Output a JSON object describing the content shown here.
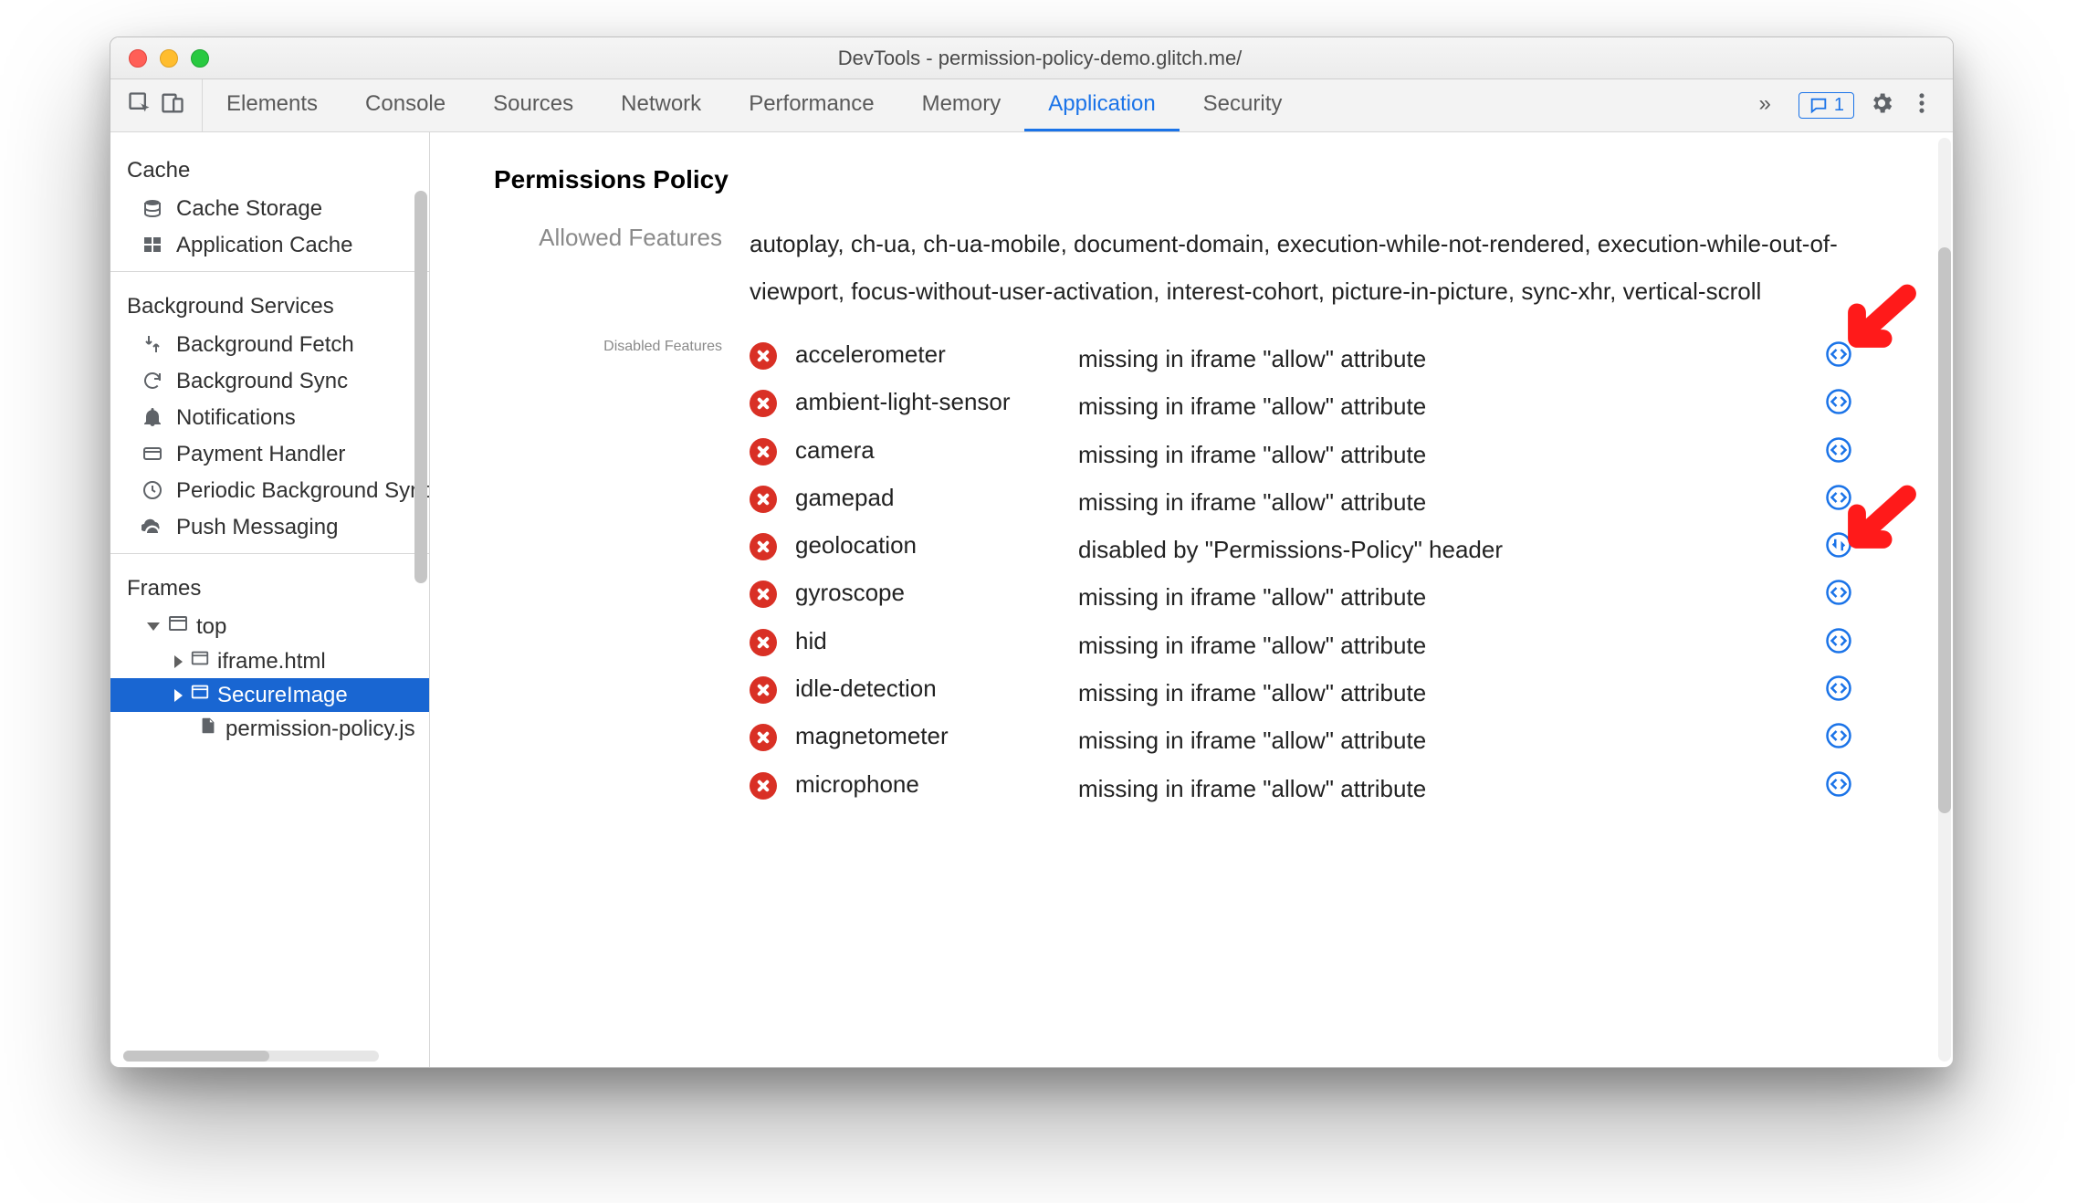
{
  "window_title": "DevTools - permission-policy-demo.glitch.me/",
  "tabs": {
    "items": [
      "Elements",
      "Console",
      "Sources",
      "Network",
      "Performance",
      "Memory",
      "Application",
      "Security"
    ],
    "active": "Application",
    "overflow_glyph": "»",
    "feedback_count": "1"
  },
  "sidebar": {
    "cache": {
      "title": "Cache",
      "items": [
        "Cache Storage",
        "Application Cache"
      ]
    },
    "bg": {
      "title": "Background Services",
      "items": [
        "Background Fetch",
        "Background Sync",
        "Notifications",
        "Payment Handler",
        "Periodic Background Sync",
        "Push Messaging"
      ]
    },
    "frames": {
      "title": "Frames",
      "top": "top",
      "children": [
        "iframe.html",
        "SecureImage",
        "permission-policy.js"
      ],
      "selected": "SecureImage"
    }
  },
  "panel": {
    "title": "Permissions Policy",
    "allowed_label": "Allowed Features",
    "allowed_text": "autoplay, ch-ua, ch-ua-mobile, document-domain, execution-while-not-rendered, execution-while-out-of-viewport, focus-without-user-activation, interest-cohort, picture-in-picture, sync-xhr, vertical-scroll",
    "disabled_label": "Disabled Features",
    "disabled": [
      {
        "name": "accelerometer",
        "reason": "missing in iframe \"allow\" attribute",
        "link": "code"
      },
      {
        "name": "ambient-light-sensor",
        "reason": "missing in iframe \"allow\" attribute",
        "link": "code"
      },
      {
        "name": "camera",
        "reason": "missing in iframe \"allow\" attribute",
        "link": "code"
      },
      {
        "name": "gamepad",
        "reason": "missing in iframe \"allow\" attribute",
        "link": "code"
      },
      {
        "name": "geolocation",
        "reason": "disabled by \"Permissions-Policy\" header",
        "link": "network"
      },
      {
        "name": "gyroscope",
        "reason": "missing in iframe \"allow\" attribute",
        "link": "code"
      },
      {
        "name": "hid",
        "reason": "missing in iframe \"allow\" attribute",
        "link": "code"
      },
      {
        "name": "idle-detection",
        "reason": "missing in iframe \"allow\" attribute",
        "link": "code"
      },
      {
        "name": "magnetometer",
        "reason": "missing in iframe \"allow\" attribute",
        "link": "code"
      },
      {
        "name": "microphone",
        "reason": "missing in iframe \"allow\" attribute",
        "link": "code"
      }
    ]
  }
}
